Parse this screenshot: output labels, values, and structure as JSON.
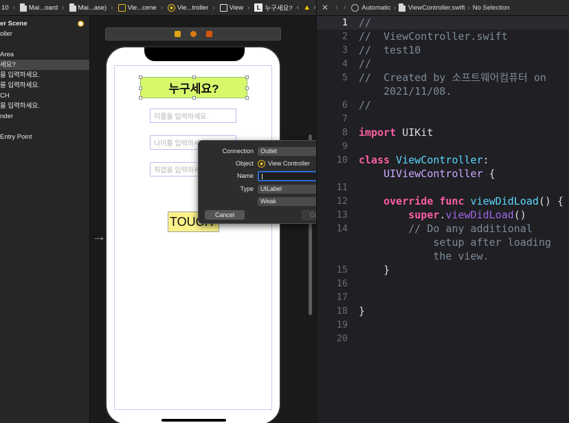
{
  "breadcrumb": {
    "items": [
      "10",
      "Mai...oard",
      "Mai...ase)",
      "Vie...cene",
      "Vie...troller",
      "View",
      "누구세요?"
    ]
  },
  "outline": {
    "rows": [
      "er Scene",
      "oller",
      "",
      "Area",
      "세요?",
      "을 입력하세요.",
      "를 입력하세요.",
      "CH",
      "을 입력하세요.",
      "nder",
      "",
      "Entry Point"
    ],
    "selected_index": 4
  },
  "scene": {
    "title_label": "누구세요?",
    "field1_placeholder": "이름을 입력하세요.",
    "field2_placeholder": "나이를 입력하세요.",
    "field3_placeholder": "직업을 입력하세요.",
    "button_label": "TOUCH"
  },
  "popover": {
    "connection_label": "Connection",
    "connection_value": "Outlet",
    "object_label": "Object",
    "object_value": "View Controller",
    "name_label": "Name",
    "type_label": "Type",
    "type_value": "UILabel",
    "storage_value": "Weak",
    "cancel_label": "Cancel",
    "connect_label": "Connect"
  },
  "editor_bar": {
    "scheme": "Automatic",
    "file": "ViewController.swift",
    "selection": "No Selection"
  },
  "editor": {
    "line_numbers": [
      "1",
      "2",
      "3",
      "4",
      "5",
      "",
      "6",
      "7",
      "8",
      "9",
      "10",
      "",
      "11",
      "12",
      "13",
      "14",
      "",
      "",
      "15",
      "16",
      "17",
      "18",
      "19",
      "20"
    ],
    "lines": {
      "l1": "//",
      "l2": "//  ViewController.swift",
      "l3": "//  test10",
      "l4": "//",
      "l5a": "//  Created by 소프트웨어컴퓨터 on",
      "l5b": "    2021/11/08.",
      "l6": "//",
      "l8_kw": "import",
      "l8_rest": " UIKit",
      "l10_kw": "class",
      "l10_ty": " ViewController",
      "l10_rest": ":",
      "l10b_ty": "    UIViewController",
      "l10b_rest": " {",
      "l12_kw": "    override func",
      "l12_fn": " viewDidLoad",
      "l12_rest": "() {",
      "l13_kw": "        super",
      "l13_rest": ".",
      "l13_fn": "viewDidLoad",
      "l13_end": "()",
      "l14a": "        // Do any additional",
      "l14b": "            setup after loading",
      "l14c": "            the view.",
      "l15": "    }",
      "l18": "}"
    }
  }
}
